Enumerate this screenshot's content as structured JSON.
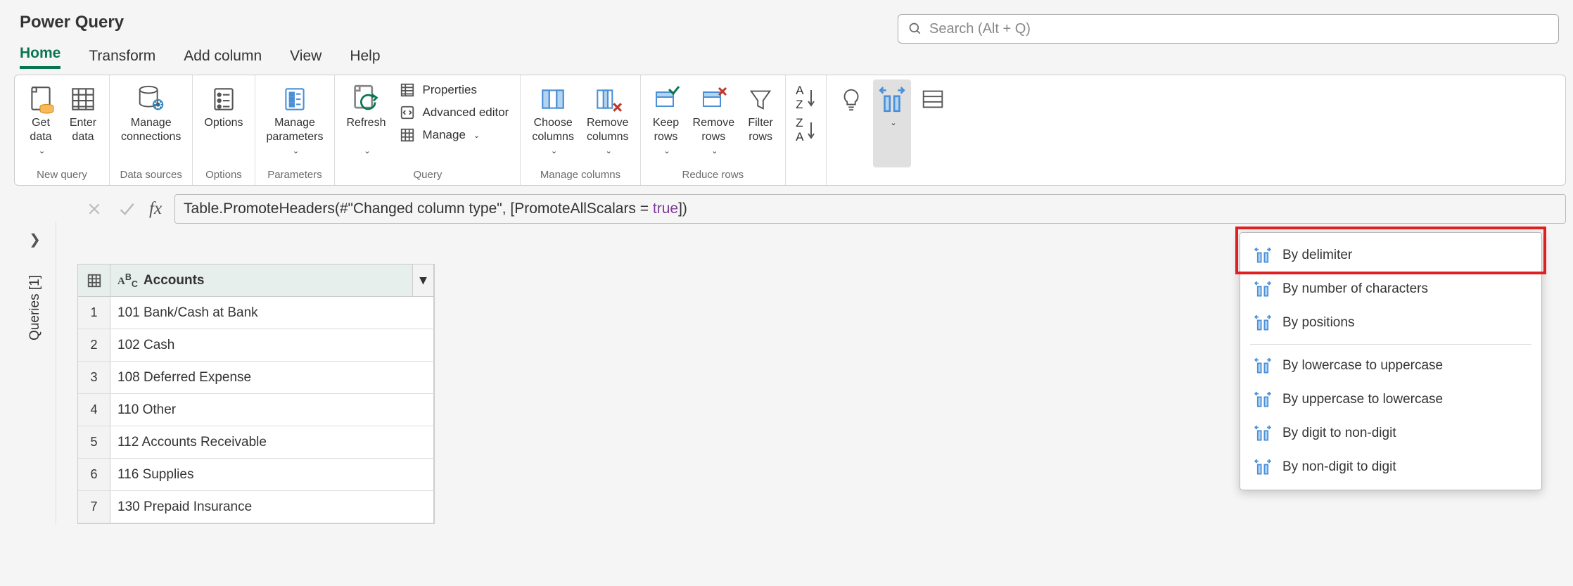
{
  "title": "Power Query",
  "search_placeholder": "Search (Alt + Q)",
  "menu": [
    "Home",
    "Transform",
    "Add column",
    "View",
    "Help"
  ],
  "ribbon": {
    "groups": {
      "new_query": {
        "label": "New query",
        "get_data": "Get\ndata",
        "enter_data": "Enter\ndata"
      },
      "data_sources": {
        "label": "Data sources",
        "manage_conn": "Manage\nconnections"
      },
      "options": {
        "label": "Options",
        "options": "Options"
      },
      "parameters": {
        "label": "Parameters",
        "manage_params": "Manage\nparameters"
      },
      "query": {
        "label": "Query",
        "refresh": "Refresh",
        "properties": "Properties",
        "advanced_editor": "Advanced editor",
        "manage": "Manage"
      },
      "manage_columns": {
        "label": "Manage columns",
        "choose": "Choose\ncolumns",
        "remove": "Remove\ncolumns"
      },
      "reduce_rows": {
        "label": "Reduce rows",
        "keep": "Keep\nrows",
        "remove": "Remove\nrows",
        "filter": "Filter\nrows"
      },
      "suggested": "Suggested\ntransforms",
      "split": "Split\ncolumn",
      "group": "Grou\nby"
    }
  },
  "formula": {
    "prefix": "Table.PromoteHeaders(#\"Changed column type\", [PromoteAllScalars = ",
    "kw": "true",
    "suffix": "])"
  },
  "queries_tab": "Queries [1]",
  "grid": {
    "column_header": "Accounts",
    "rows": [
      "101 Bank/Cash at Bank",
      "102 Cash",
      "108 Deferred Expense",
      "110 Other",
      "112 Accounts Receivable",
      "116 Supplies",
      "130 Prepaid Insurance"
    ]
  },
  "split_menu": [
    "By delimiter",
    "By number of characters",
    "By positions",
    "By lowercase to uppercase",
    "By uppercase to lowercase",
    "By digit to non-digit",
    "By non-digit to digit"
  ]
}
